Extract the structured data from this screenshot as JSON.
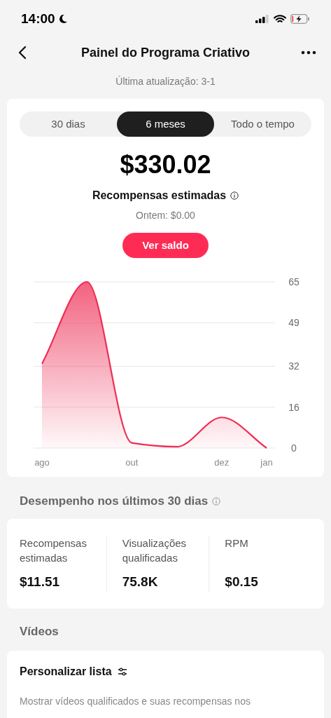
{
  "status_bar": {
    "time": "14:00"
  },
  "header": {
    "title": "Painel do Programa Criativo"
  },
  "last_update": "Última atualização: 3-1",
  "tabs": [
    {
      "label": "30 dias",
      "selected": false
    },
    {
      "label": "6 meses",
      "selected": true
    },
    {
      "label": "Todo o tempo",
      "selected": false
    }
  ],
  "summary": {
    "amount": "$330.02",
    "label": "Recompensas estimadas",
    "yesterday": "Ontem: $0.00",
    "button": "Ver saldo"
  },
  "chart_data": {
    "type": "area",
    "categories": [
      "ago",
      null,
      "out",
      null,
      "dez",
      "jan"
    ],
    "series": [
      {
        "color": "#ee2e55",
        "values": [
          33,
          65,
          2,
          0.5,
          12,
          0
        ]
      }
    ],
    "ylim": [
      0,
      65
    ],
    "yticks": [
      0,
      16,
      32,
      49,
      65
    ],
    "grid": true
  },
  "performance": {
    "title": "Desempenho nos últimos 30 dias",
    "metrics": [
      {
        "label": "Recompensas estimadas",
        "value": "$11.51"
      },
      {
        "label": "Visualizações qualificadas",
        "value": "75.8K"
      },
      {
        "label": "RPM",
        "value": "$0.15"
      }
    ]
  },
  "videos": {
    "title": "Vídeos",
    "customize": "Personalizar lista",
    "description": "Mostrar vídeos qualificados e suas recompensas nos"
  }
}
